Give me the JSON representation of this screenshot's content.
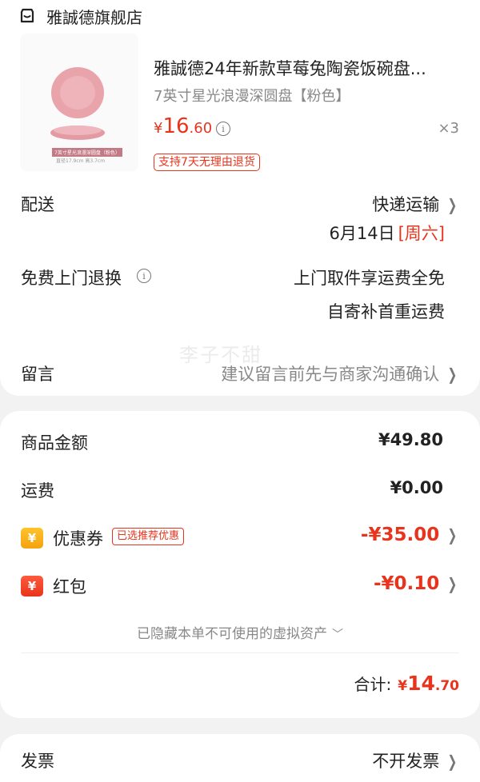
{
  "store": {
    "name": "雅誠德旗舰店",
    "icon": "store-icon"
  },
  "product": {
    "title": "雅誠德24年新款草莓兔陶瓷饭碗盘...",
    "spec": "7英寸星光浪漫深圆盘【粉色】",
    "price_symbol": "¥",
    "price_int": "16",
    "price_dec": ".60",
    "qty": "×3",
    "return_policy": "支持7天无理由退货",
    "thumb_caption": "7英寸星光浪漫深圆盘（粉色）",
    "thumb_size": "直径17.9cm 高3.7cm"
  },
  "delivery": {
    "label": "配送",
    "method": "快递运输",
    "date": "6月14日",
    "weekday": "[周六]"
  },
  "return_service": {
    "label": "免费上门退换",
    "line1": "上门取件享运费全免",
    "line2": "自寄补首重运费"
  },
  "watermark": "李子不甜",
  "note": {
    "label": "留言",
    "placeholder": "建议留言前先与商家沟通确认"
  },
  "summary": {
    "goods_label": "商品金额",
    "goods_value": "¥49.80",
    "shipping_label": "运费",
    "shipping_value": "¥0.00",
    "coupon_label": "优惠券",
    "coupon_badge": "已选推荐优惠",
    "coupon_value": "-¥35.00",
    "redpacket_label": "红包",
    "redpacket_value": "-¥0.10",
    "hidden_assets": "已隐藏本单不可使用的虚拟资产",
    "total_label": "合计:",
    "total_symbol": "¥",
    "total_int": "14",
    "total_dec": ".70"
  },
  "bottom": {
    "left_label": "发票",
    "right_label": "不开发票"
  },
  "colors": {
    "accent": "#e8341c",
    "muted": "#888888",
    "coupon": "#f5a210"
  }
}
